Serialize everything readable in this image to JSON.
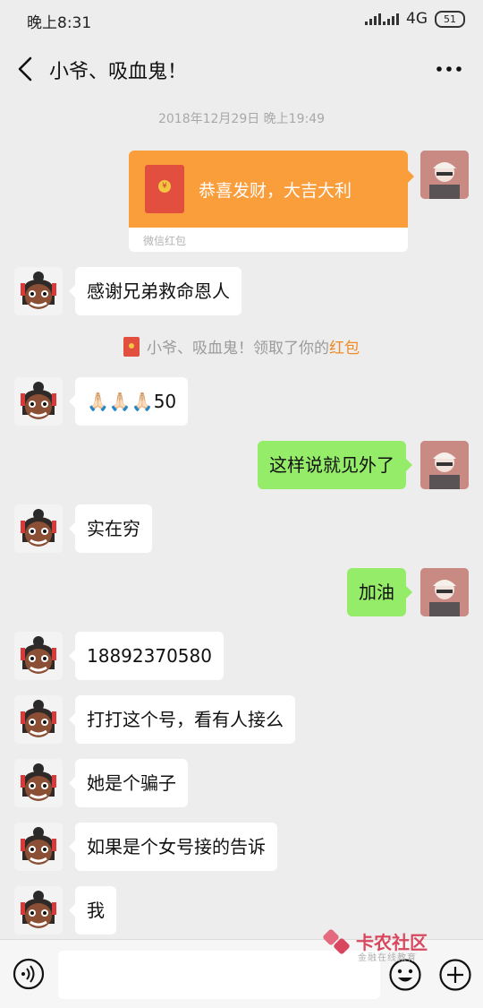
{
  "status_bar": {
    "time": "晚上8:31",
    "network": "4G",
    "battery": "51"
  },
  "header": {
    "title": "小爷、吸血鬼！",
    "back_icon": "back-arrow-icon",
    "more_icon": "more-icon"
  },
  "timestamp": "2018年12月29日 晚上19:49",
  "red_packet": {
    "title": "恭喜发财，大吉大利",
    "footer": "微信红包"
  },
  "messages": [
    {
      "side": "left",
      "text": "感谢兄弟救命恩人"
    },
    {
      "side": "left",
      "text": "🙏🏻🙏🏻🙏🏻50"
    },
    {
      "side": "right",
      "text": "这样说就见外了"
    },
    {
      "side": "left",
      "text": "实在穷"
    },
    {
      "side": "right",
      "text": "加油"
    },
    {
      "side": "left",
      "text": "18892370580"
    },
    {
      "side": "left",
      "text": "打打这个号，看有人接么"
    },
    {
      "side": "left",
      "text": "她是个骗子"
    },
    {
      "side": "left",
      "text": "如果是个女号接的告诉"
    },
    {
      "side": "left",
      "text": "我"
    }
  ],
  "system_notice": {
    "text": "小爷、吸血鬼！领取了你的",
    "link": "红包"
  },
  "input_bar": {
    "value": ""
  },
  "watermark": {
    "name": "卡农社区",
    "sub": "金融在线教育"
  },
  "colors": {
    "bg": "#ededed",
    "bubble_right": "#95ec69",
    "red_packet": "#fa9d3b"
  }
}
